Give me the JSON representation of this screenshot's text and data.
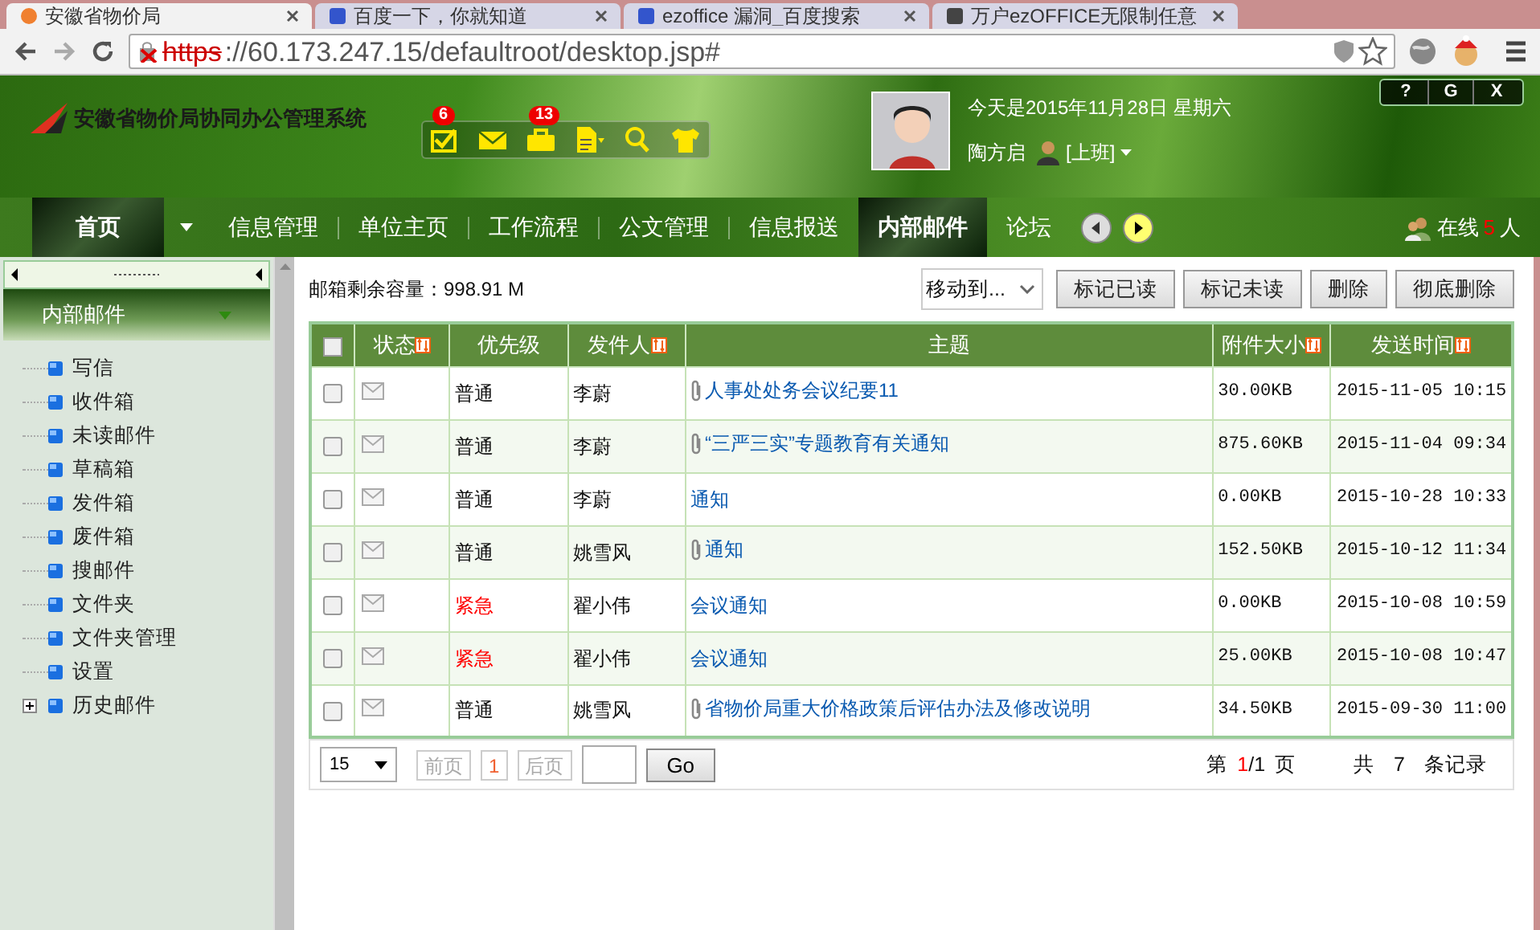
{
  "browser": {
    "tabs": [
      {
        "title": "安徽省物价局",
        "selected": true
      },
      {
        "title": "百度一下，你就知道",
        "selected": false
      },
      {
        "title": "ezoffice 漏洞_百度搜索",
        "selected": false
      },
      {
        "title": "万户ezOFFICE无限制任意",
        "selected": false
      }
    ],
    "url_scheme": "https",
    "url_rest": "://60.173.247.15/defaultroot/desktop.jsp#"
  },
  "header": {
    "system_title": "安徽省物价局协同办公管理系统",
    "toolbar": [
      {
        "kind": "todo",
        "badge": "6"
      },
      {
        "kind": "mail"
      },
      {
        "kind": "briefcase",
        "badge": "13"
      },
      {
        "kind": "document"
      },
      {
        "kind": "search"
      },
      {
        "kind": "skin"
      }
    ],
    "date": "今天是2015年11月28日 星期六",
    "user": "陶方启",
    "status": "[上班]",
    "window_buttons": [
      "?",
      "G",
      "X"
    ]
  },
  "nav": {
    "home": "首页",
    "items": [
      {
        "label": "信息管理",
        "selected": false
      },
      {
        "label": "单位主页",
        "selected": false
      },
      {
        "label": "工作流程",
        "selected": false
      },
      {
        "label": "公文管理",
        "selected": false
      },
      {
        "label": "信息报送",
        "selected": false
      },
      {
        "label": "内部邮件",
        "selected": true
      },
      {
        "label": "论坛",
        "selected": false
      }
    ],
    "online_prefix": "在线",
    "online_count": "5",
    "online_suffix": "人"
  },
  "sidebar": {
    "title": "内部邮件",
    "items": [
      {
        "label": "写信"
      },
      {
        "label": "收件箱"
      },
      {
        "label": "未读邮件"
      },
      {
        "label": "草稿箱"
      },
      {
        "label": "发件箱"
      },
      {
        "label": "废件箱"
      },
      {
        "label": "搜邮件"
      },
      {
        "label": "文件夹"
      },
      {
        "label": "文件夹管理"
      },
      {
        "label": "设置"
      },
      {
        "label": "历史邮件",
        "expandable": true,
        "expanded": false
      }
    ]
  },
  "mailbox": {
    "capacity": "邮箱剩余容量：998.91 M",
    "move_to": "移动到...",
    "actions": [
      "标记已读",
      "标记未读",
      "删除",
      "彻底删除"
    ]
  },
  "table": {
    "select_all_checked": false,
    "columns": [
      {
        "label": "状态",
        "sortable": true
      },
      {
        "label": "优先级",
        "sortable": false
      },
      {
        "label": "发件人",
        "sortable": true
      },
      {
        "label": "主题",
        "sortable": false
      },
      {
        "label": "附件大小",
        "sortable": true
      },
      {
        "label": "发送时间",
        "sortable": true
      }
    ],
    "rows": [
      {
        "checked": false,
        "priority": "普通",
        "urgent": false,
        "sender": "李蔚",
        "attachment": true,
        "subject": "人事处处务会议纪要11",
        "size": "30.00KB",
        "time": "2015-11-05 10:15"
      },
      {
        "checked": false,
        "priority": "普通",
        "urgent": false,
        "sender": "李蔚",
        "attachment": true,
        "subject": "“三严三实”专题教育有关通知",
        "size": "875.60KB",
        "time": "2015-11-04 09:34"
      },
      {
        "checked": false,
        "priority": "普通",
        "urgent": false,
        "sender": "李蔚",
        "attachment": false,
        "subject": "通知",
        "size": "0.00KB",
        "time": "2015-10-28 10:33"
      },
      {
        "checked": false,
        "priority": "普通",
        "urgent": false,
        "sender": "姚雪风",
        "attachment": true,
        "subject": "通知",
        "size": "152.50KB",
        "time": "2015-10-12 11:34"
      },
      {
        "checked": false,
        "priority": "紧急",
        "urgent": true,
        "sender": "翟小伟",
        "attachment": false,
        "subject": "会议通知",
        "size": "0.00KB",
        "time": "2015-10-08 10:59"
      },
      {
        "checked": false,
        "priority": "紧急",
        "urgent": true,
        "sender": "翟小伟",
        "attachment": false,
        "subject": "会议通知",
        "size": "25.00KB",
        "time": "2015-10-08 10:47"
      },
      {
        "checked": false,
        "priority": "普通",
        "urgent": false,
        "sender": "姚雪风",
        "attachment": true,
        "subject": "省物价局重大价格政策后评估办法及修改说明",
        "size": "34.50KB",
        "time": "2015-09-30 11:00"
      }
    ]
  },
  "pagination": {
    "page_size": "15",
    "prev": "前页",
    "current": "1",
    "next": "后页",
    "go": "Go",
    "page_prefix": "第",
    "page_current": "1",
    "page_total": "/1",
    "page_suffix": "页",
    "total_prefix": "共",
    "total": "7",
    "total_suffix": "条记录"
  }
}
